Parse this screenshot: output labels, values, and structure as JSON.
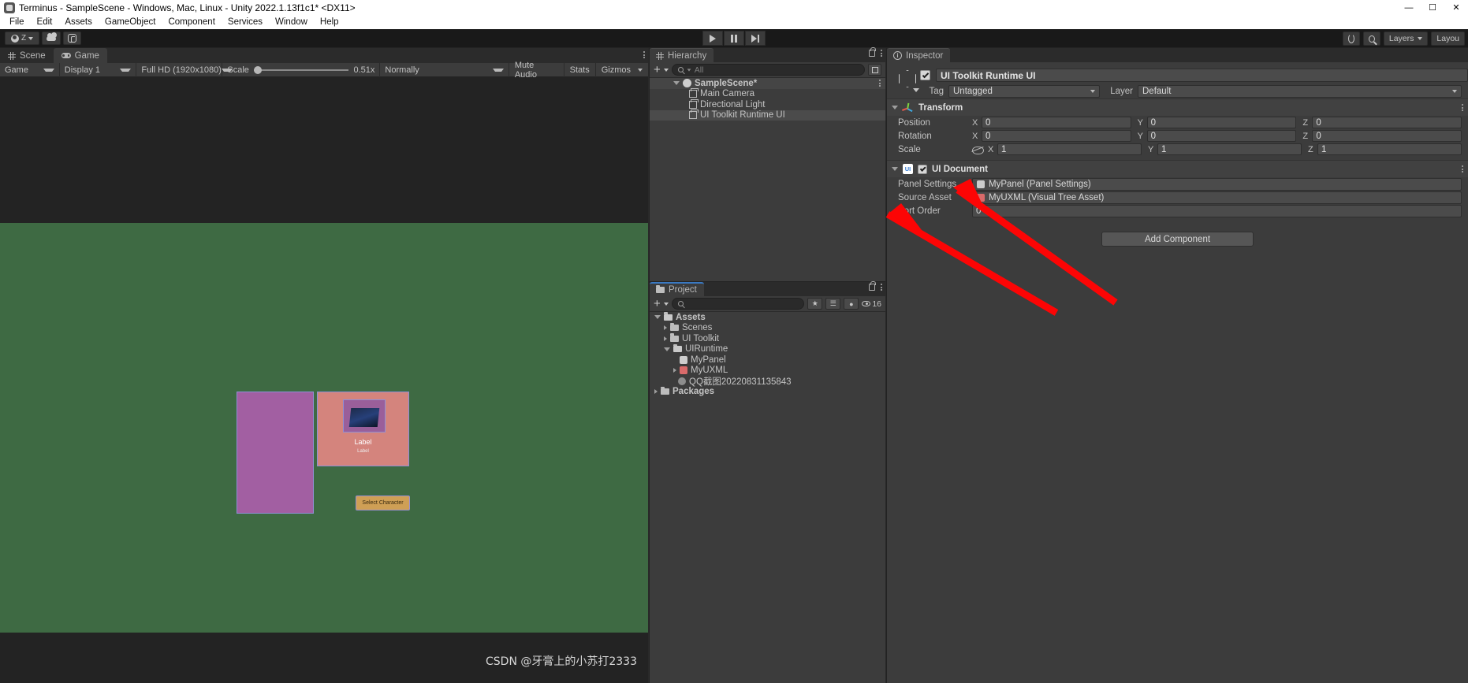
{
  "window": {
    "title": "Terminus - SampleScene - Windows, Mac, Linux - Unity 2022.1.13f1c1* <DX11>",
    "minimize": "—",
    "maximize": "☐",
    "close": "✕"
  },
  "menubar": {
    "items": [
      "File",
      "Edit",
      "Assets",
      "GameObject",
      "Component",
      "Services",
      "Window",
      "Help"
    ]
  },
  "toolbar": {
    "account_label": "Z",
    "cloud_label": "",
    "collab_label": "",
    "layers_label": "Layers",
    "layout_label": "Layou",
    "play": "▶",
    "pause": "⏸",
    "step": "⏭"
  },
  "game_view": {
    "tabs": [
      {
        "label": "Scene",
        "icon": "grid-icon",
        "active": false
      },
      {
        "label": "Game",
        "icon": "gamepad-icon",
        "active": true
      }
    ],
    "toolbar": {
      "target": "Game",
      "display": "Display 1",
      "resolution": "Full HD (1920x1080)",
      "scale_label": "Scale",
      "scale_value": "0.51x",
      "scale_percent": 8,
      "play_mode": "Normally",
      "mute_audio": "Mute Audio",
      "stats": "Stats",
      "gizmos": "Gizmos"
    },
    "content": {
      "card_caption": "Label",
      "card_subcaption": "Label",
      "button_label": "Select Character"
    },
    "watermark": "CSDN @牙膏上的小苏打2333"
  },
  "hierarchy": {
    "tab_label": "Hierarchy",
    "search_placeholder": "All",
    "add_label": "+",
    "items": [
      {
        "label": "SampleScene*",
        "depth": 0,
        "icon": "unity-scene-icon",
        "expanded": true,
        "selected": false
      },
      {
        "label": "Main Camera",
        "depth": 1,
        "icon": "gameobject-cube-icon",
        "expanded": false,
        "selected": false
      },
      {
        "label": "Directional Light",
        "depth": 1,
        "icon": "gameobject-cube-icon",
        "expanded": false,
        "selected": false
      },
      {
        "label": "UI Toolkit Runtime UI",
        "depth": 1,
        "icon": "gameobject-cube-icon",
        "expanded": false,
        "selected": true
      }
    ]
  },
  "project": {
    "tab_label": "Project",
    "search_placeholder": "",
    "add_label": "+",
    "item_count": "16",
    "items": [
      {
        "label": "Assets",
        "depth": 0,
        "icon": "folder-open-icon",
        "expanded": true
      },
      {
        "label": "Scenes",
        "depth": 1,
        "icon": "folder-icon",
        "expanded": false
      },
      {
        "label": "UI Toolkit",
        "depth": 1,
        "icon": "folder-icon",
        "expanded": false
      },
      {
        "label": "UIRuntime",
        "depth": 1,
        "icon": "folder-open-icon",
        "expanded": true
      },
      {
        "label": "MyPanel",
        "depth": 2,
        "icon": "panel-settings-icon",
        "expanded": null
      },
      {
        "label": "MyUXML",
        "depth": 2,
        "icon": "uxml-icon",
        "expanded": null
      },
      {
        "label": "QQ截图20220831135843",
        "depth": 2,
        "icon": "image-asset-icon",
        "expanded": null
      },
      {
        "label": "Packages",
        "depth": 0,
        "icon": "folder-icon",
        "expanded": false
      }
    ]
  },
  "inspector": {
    "tab_label": "Inspector",
    "object_name": "UI Toolkit Runtime UI",
    "enabled": true,
    "tag_label": "Tag",
    "tag_value": "Untagged",
    "layer_label": "Layer",
    "layer_value": "Default",
    "components": [
      {
        "name": "Transform",
        "icon": "transform-axis-icon",
        "expanded": true,
        "has_checkbox": false,
        "rows": [
          {
            "label": "Position",
            "x": "0",
            "y": "0",
            "z": "0",
            "link": false
          },
          {
            "label": "Rotation",
            "x": "0",
            "y": "0",
            "z": "0",
            "link": false
          },
          {
            "label": "Scale",
            "x": "1",
            "y": "1",
            "z": "1",
            "link": true
          }
        ]
      },
      {
        "name": "UI Document",
        "icon": "ui-document-icon",
        "expanded": true,
        "has_checkbox": true,
        "fields": [
          {
            "label": "Panel Settings",
            "value": "MyPanel (Panel Settings)",
            "icon": "panel-settings-icon",
            "type": "object"
          },
          {
            "label": "Source Asset",
            "value": "MyUXML (Visual Tree Asset)",
            "icon": "uxml-icon",
            "type": "object"
          },
          {
            "label": "Sort Order",
            "value": "0",
            "icon": "",
            "type": "number"
          }
        ]
      }
    ],
    "add_component_label": "Add Component",
    "axis_labels": {
      "x": "X",
      "y": "Y",
      "z": "Z"
    }
  },
  "colors": {
    "accent_blue": "#3a79c2",
    "arrow_red": "#fc0505",
    "game_ground": "#3e6a43",
    "game_sky": "#232323",
    "panel_bg": "#3c3c3c",
    "ui_purple": "#a25fa2",
    "ui_card": "#d4847d",
    "ui_button": "#cf9f55"
  }
}
